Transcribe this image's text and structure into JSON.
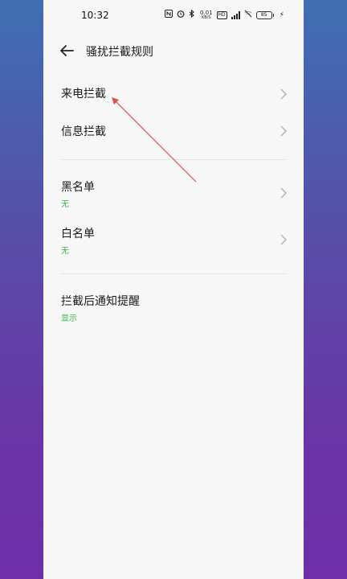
{
  "status_bar": {
    "time": "10:32",
    "icons": [
      "nfc-icon",
      "alarm-icon",
      "bluetooth-icon",
      "net-speed",
      "hd-icon",
      "signal-icon",
      "wifi-off-icon",
      "battery-icon",
      "charging-icon"
    ],
    "net_speed_value": "0.01",
    "net_speed_unit": "KB/S",
    "hd_label": "HD",
    "battery_level": "85"
  },
  "header": {
    "back_icon": "arrow-left-icon",
    "title": "骚扰拦截规则"
  },
  "sections": {
    "call_block": {
      "label": "来电拦截"
    },
    "sms_block": {
      "label": "信息拦截"
    },
    "blacklist": {
      "label": "黑名单",
      "sub": "无"
    },
    "whitelist": {
      "label": "白名单",
      "sub": "无"
    },
    "notify": {
      "label": "拦截后通知提醒",
      "sub": "显示"
    }
  },
  "colors": {
    "accent_green": "#3bb34a",
    "annotation_red": "#d9534f",
    "page_bg": "#f7f7f7"
  }
}
